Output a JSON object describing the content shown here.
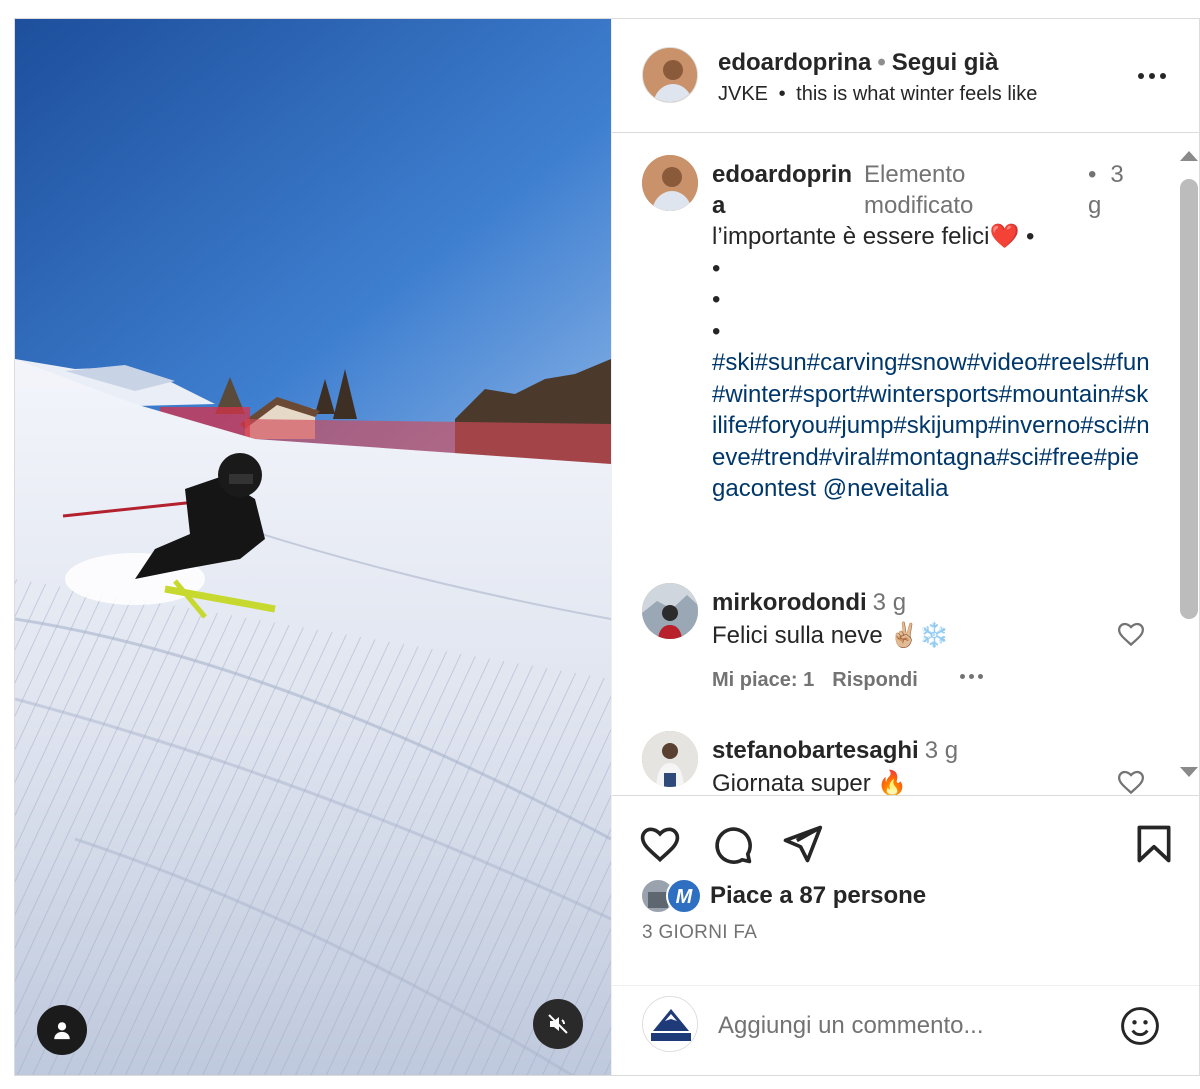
{
  "header": {
    "username": "edoardoprina",
    "separator": "•",
    "follow_status": "Segui già",
    "audio_artist": "JVKE",
    "audio_separator": "•",
    "audio_title": "this is what winter feels like"
  },
  "caption": {
    "username": "edoardoprina",
    "edited_label": "Elemento modificato",
    "separator": "•",
    "time": "3 g",
    "text_lines": [
      "l’importante è essere felici❤️ •",
      "•",
      "•",
      "•"
    ],
    "hashtags": "#ski#sun#carving#snow#video#reels#fun#winter#sport#wintersports#mountain#skilife#foryou#jump#skijump#inverno#sci#neve#trend#viral#montagna#sci#free#piegacontest @neveitalia"
  },
  "comments": [
    {
      "username": "mirkorodondi",
      "time": "3 g",
      "text": "Felici sulla neve ✌🏼❄️",
      "likes": "Mi piace: 1",
      "reply": "Rispondi"
    },
    {
      "username": "stefanobartesaghi",
      "time": "3 g",
      "text": "Giornata super 🔥"
    }
  ],
  "actions": {
    "likes_text": "Piace a 87 persone",
    "post_time": "3 GIORNI FA"
  },
  "add_comment": {
    "placeholder": "Aggiungi un commento..."
  },
  "icons": {
    "like": "heart-icon",
    "comment": "comment-bubble-icon",
    "share": "paper-plane-icon",
    "save": "bookmark-icon",
    "emoji": "smiley-icon",
    "user_tag": "person-icon",
    "mute": "speaker-muted-icon"
  },
  "colors": {
    "hashtag": "#00376b",
    "text": "#262626",
    "muted": "#737373",
    "border": "#dbdbdb"
  }
}
